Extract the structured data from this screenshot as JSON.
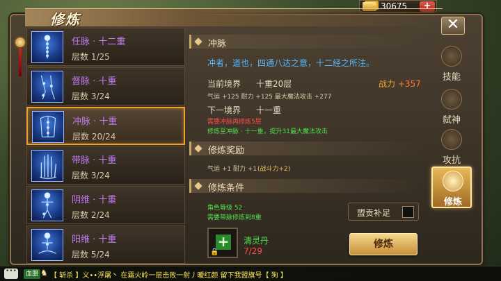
{
  "currency": {
    "amount": "30675",
    "add_label": "+"
  },
  "window": {
    "title": "修炼",
    "close_label": "✕"
  },
  "meridians": [
    {
      "name": "任脉 · 十二重",
      "level": "层数 1/25",
      "icon": "meridian-figure-icon"
    },
    {
      "name": "督脉 · 十重",
      "level": "层数 3/24",
      "icon": "meridian-leg-icon"
    },
    {
      "name": "冲脉 · 十重",
      "level": "层数 20/24",
      "icon": "meridian-torso-icon",
      "selected": true
    },
    {
      "name": "带脉 · 十重",
      "level": "层数 3/24",
      "icon": "meridian-hand-icon"
    },
    {
      "name": "阴维 · 十重",
      "level": "层数 2/24",
      "icon": "meridian-body-icon"
    },
    {
      "name": "阳维 · 十重",
      "level": "层数 5/24",
      "icon": "meridian-meditation-icon"
    }
  ],
  "detail": {
    "section_title": "冲脉",
    "description": "冲者，道也，四通八达之意，十二经之所注。",
    "current": {
      "label": "当前境界",
      "value": "十重20层",
      "stats": "气运 +125 耐力 +125 最大魔法攻击 +277",
      "power_label": "战力",
      "power_value": "+357"
    },
    "next": {
      "label": "下一境界",
      "value": "十一重",
      "requirement": "需要冲脉再修炼5层",
      "effect": "修炼至冲脉 · 十一重，提升31最大魔法攻击"
    },
    "reward": {
      "title": "修炼奖励",
      "stats": "气运 +1 耐力 +1",
      "power": "(战斗力+2)"
    },
    "conditions": {
      "title": "修炼条件",
      "role_level": "角色等级  52",
      "requirement": "需要带脉修炼到8重",
      "tribute_label": "盟贡补足",
      "item_name": "清灵丹",
      "item_count": "7/29",
      "train_button": "修炼"
    }
  },
  "tabs": [
    {
      "label": "技能",
      "icon": "skill-emblem-icon"
    },
    {
      "label": "弑神",
      "icon": "godslayer-emblem-icon"
    },
    {
      "label": "攻抗",
      "icon": "resist-emblem-icon"
    },
    {
      "label": "修炼",
      "icon": "cultivate-emblem-icon",
      "active": true
    }
  ],
  "chat": {
    "channel": "血盟",
    "message": "【 斩杀 】义••浮屠丶 在霜火岭一层击败一射丿暖红颜  留下我盟旗号【 狗 】"
  },
  "colors": {
    "accent": "#f0a030",
    "quality_purple": "#c27cf2",
    "desc_blue": "#55b8ff",
    "warn_red": "#ff4a4a",
    "ok_green": "#4ee04e"
  }
}
